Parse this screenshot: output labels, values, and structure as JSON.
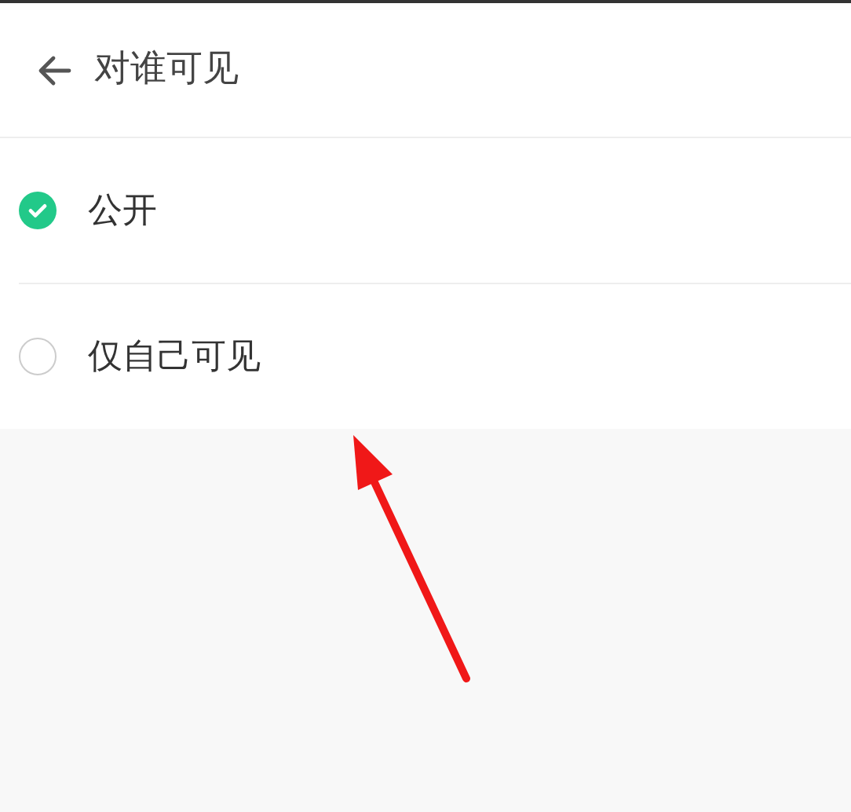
{
  "header": {
    "title": "对谁可见"
  },
  "options": [
    {
      "label": "公开",
      "selected": true
    },
    {
      "label": "仅自己可见",
      "selected": false
    }
  ]
}
